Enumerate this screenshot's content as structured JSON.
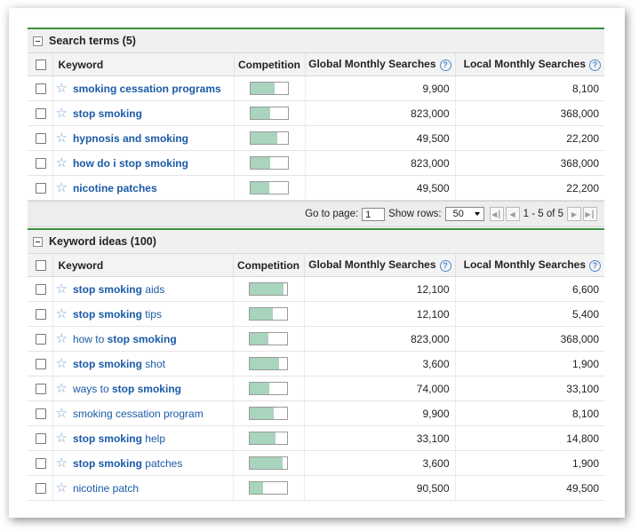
{
  "search_terms": {
    "title": "Search terms (5)",
    "columns": {
      "keyword": "Keyword",
      "competition": "Competition",
      "global": "Global Monthly Searches",
      "local": "Local Monthly Searches"
    },
    "rows": [
      {
        "parts": [
          {
            "t": "smoking cessation programs",
            "b": true
          }
        ],
        "competition": 0.65,
        "global": "9,900",
        "local": "8,100"
      },
      {
        "parts": [
          {
            "t": "stop smoking",
            "b": true
          }
        ],
        "competition": 0.53,
        "global": "823,000",
        "local": "368,000"
      },
      {
        "parts": [
          {
            "t": "hypnosis and smoking",
            "b": true
          }
        ],
        "competition": 0.71,
        "global": "49,500",
        "local": "22,200"
      },
      {
        "parts": [
          {
            "t": "how do i stop smoking",
            "b": true
          }
        ],
        "competition": 0.53,
        "global": "823,000",
        "local": "368,000"
      },
      {
        "parts": [
          {
            "t": "nicotine patches",
            "b": true
          }
        ],
        "competition": 0.5,
        "global": "49,500",
        "local": "22,200"
      }
    ],
    "pager": {
      "goto_label": "Go to page:",
      "page": "1",
      "rows_label": "Show rows:",
      "rows_value": "50",
      "range": "1 - 5 of 5"
    }
  },
  "keyword_ideas": {
    "title": "Keyword ideas (100)",
    "columns": {
      "keyword": "Keyword",
      "competition": "Competition",
      "global": "Global Monthly Searches",
      "local": "Local Monthly Searches"
    },
    "rows": [
      {
        "parts": [
          {
            "t": "stop smoking",
            "b": true
          },
          {
            "t": " aids",
            "b": false
          }
        ],
        "competition": 0.9,
        "global": "12,100",
        "local": "6,600"
      },
      {
        "parts": [
          {
            "t": "stop smoking",
            "b": true
          },
          {
            "t": " tips",
            "b": false
          }
        ],
        "competition": 0.63,
        "global": "12,100",
        "local": "5,400"
      },
      {
        "parts": [
          {
            "t": "how to ",
            "b": false
          },
          {
            "t": "stop smoking",
            "b": true
          }
        ],
        "competition": 0.5,
        "global": "823,000",
        "local": "368,000"
      },
      {
        "parts": [
          {
            "t": "stop smoking",
            "b": true
          },
          {
            "t": " shot",
            "b": false
          }
        ],
        "competition": 0.78,
        "global": "3,600",
        "local": "1,900"
      },
      {
        "parts": [
          {
            "t": "ways to ",
            "b": false
          },
          {
            "t": "stop smoking",
            "b": true
          }
        ],
        "competition": 0.53,
        "global": "74,000",
        "local": "33,100"
      },
      {
        "parts": [
          {
            "t": "smoking cessation program",
            "b": false
          }
        ],
        "competition": 0.65,
        "global": "9,900",
        "local": "8,100"
      },
      {
        "parts": [
          {
            "t": "stop smoking",
            "b": true
          },
          {
            "t": " help",
            "b": false
          }
        ],
        "competition": 0.68,
        "global": "33,100",
        "local": "14,800"
      },
      {
        "parts": [
          {
            "t": "stop smoking",
            "b": true
          },
          {
            "t": " patches",
            "b": false
          }
        ],
        "competition": 0.88,
        "global": "3,600",
        "local": "1,900"
      },
      {
        "parts": [
          {
            "t": "nicotine patch",
            "b": false
          }
        ],
        "competition": 0.35,
        "global": "90,500",
        "local": "49,500"
      }
    ]
  },
  "icons": {
    "collapse": "collapse-minus-icon",
    "star": "star-outline-icon",
    "help": "help-question-icon",
    "pager": [
      "first-page-icon",
      "prev-page-icon",
      "next-page-icon",
      "last-page-icon"
    ]
  },
  "colors": {
    "link": "#1a5aa6",
    "accent_border": "#3a8f3a",
    "competition_fill": "#a9d4bd"
  }
}
